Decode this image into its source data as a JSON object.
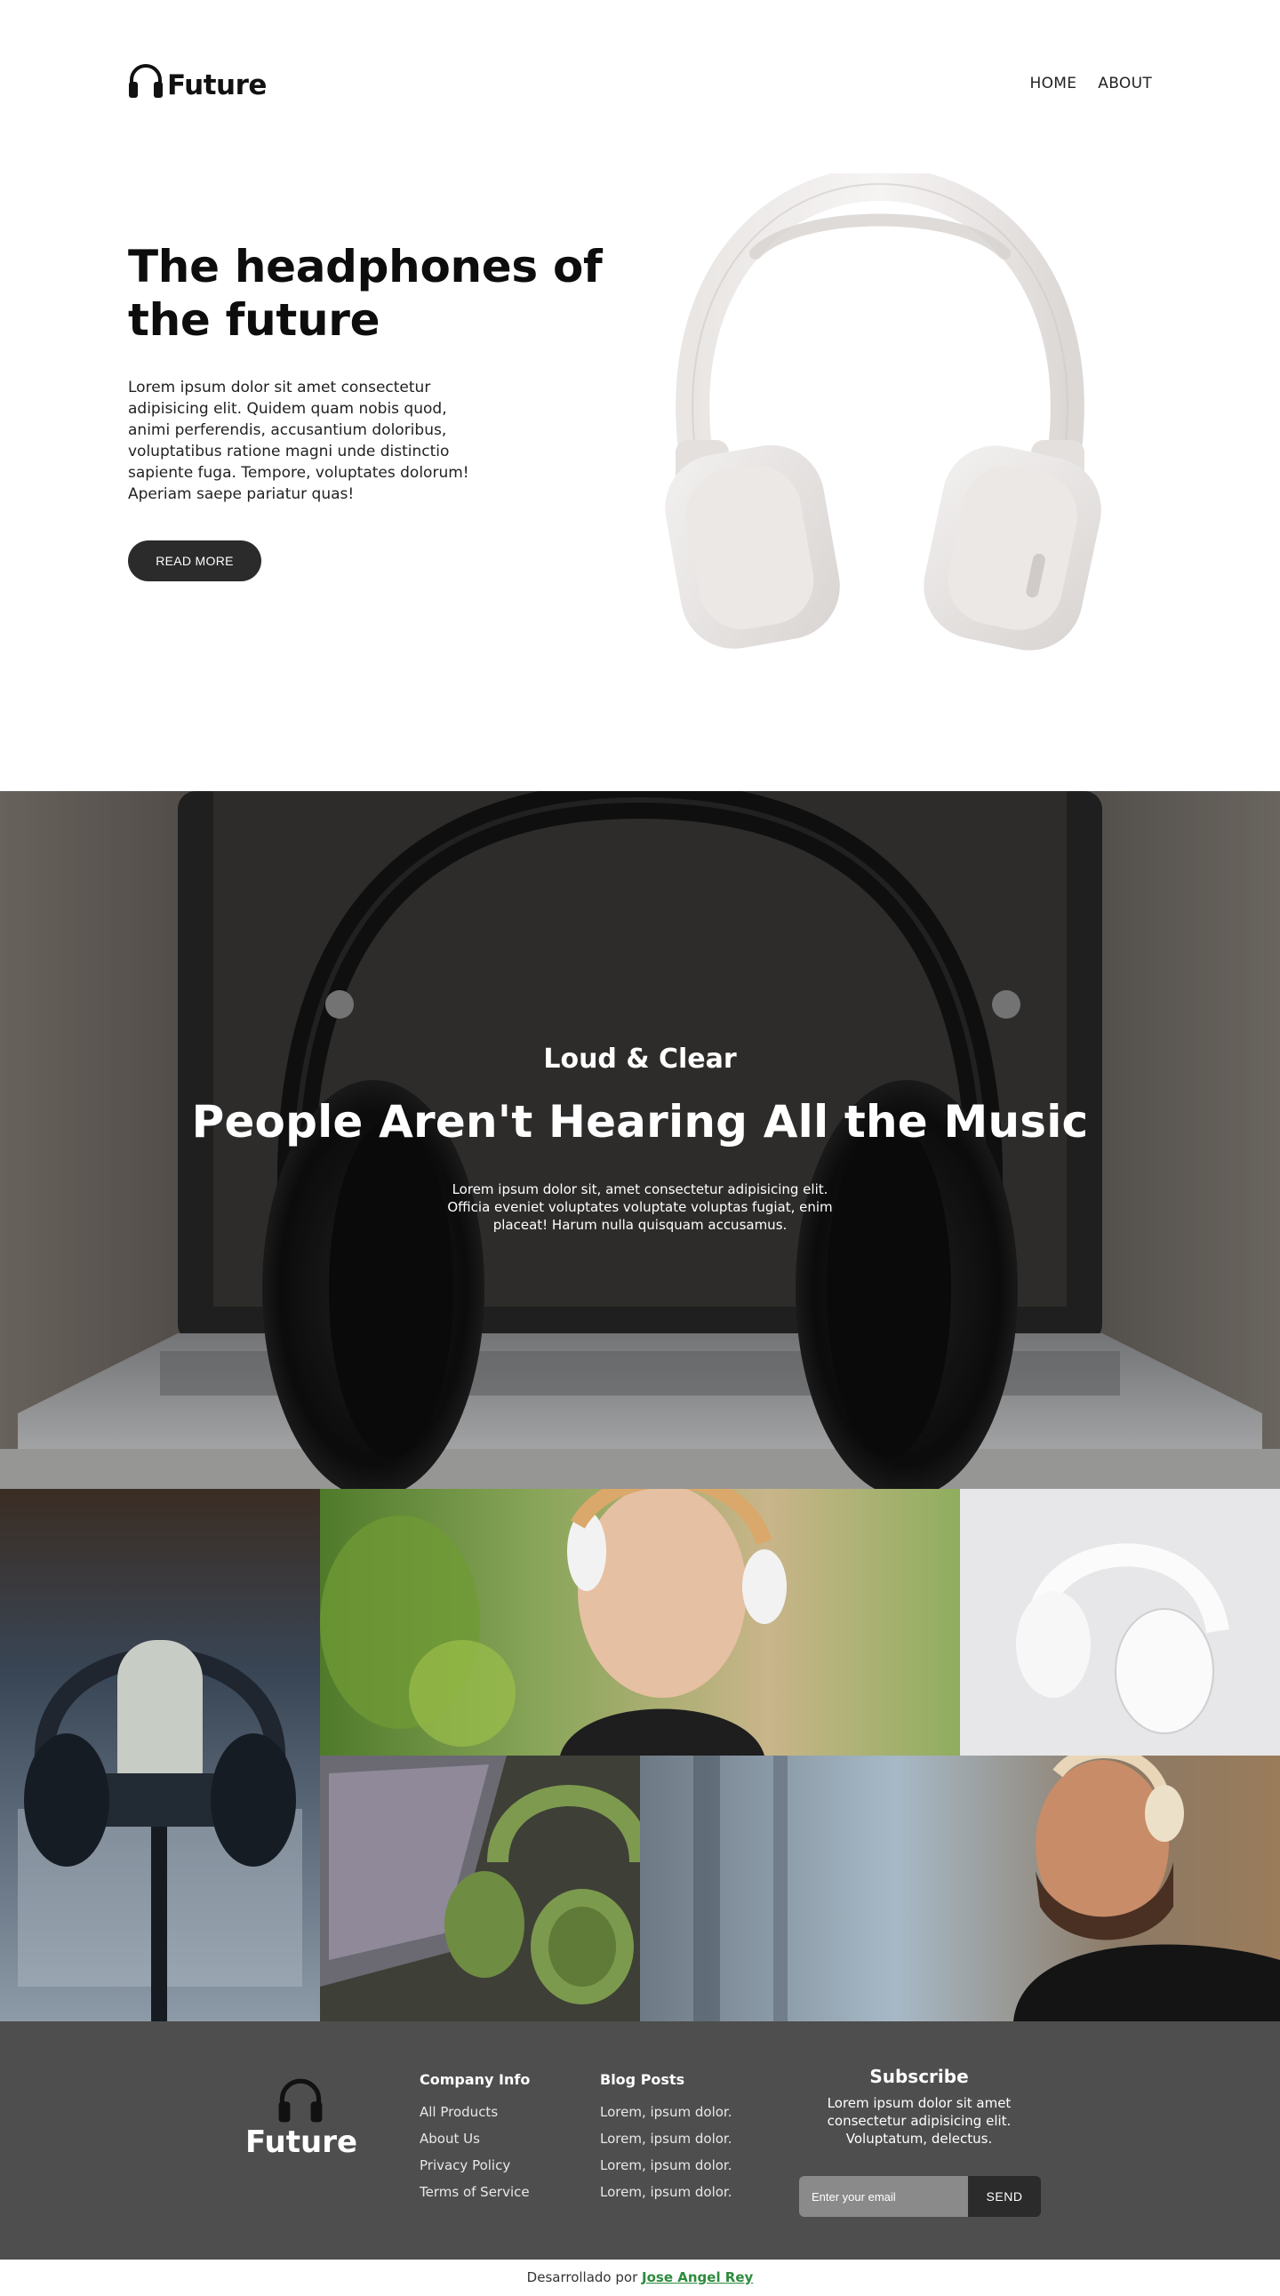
{
  "header": {
    "brand": "Future",
    "nav": [
      {
        "label": "HOME"
      },
      {
        "label": "ABOUT"
      }
    ]
  },
  "hero": {
    "title": "The headphones of the future",
    "text": "Lorem ipsum dolor sit amet consectetur adipisicing elit. Quidem quam nobis quod, animi perferendis, accusantium doloribus, voluptatibus ratione magni unde distinctio sapiente fuga. Tempore, voluptates dolorum! Aperiam saepe pariatur quas!",
    "button_label": "READ MORE"
  },
  "banner": {
    "subtitle": "Loud & Clear",
    "title": "People Aren't Hearing All the Music",
    "text": "Lorem ipsum dolor sit, amet consectetur adipisicing elit. Officia eveniet voluptates voluptate voluptas fugiat, enim placeat! Harum nulla quisquam accusamus."
  },
  "gallery": {
    "images": [
      {
        "name": "microphone-with-headphones-photo"
      },
      {
        "name": "woman-listening-photo"
      },
      {
        "name": "white-headphones-photo"
      },
      {
        "name": "green-headphones-photo"
      },
      {
        "name": "smiling-man-photo"
      }
    ]
  },
  "footer": {
    "brand": "Future",
    "company": {
      "heading": "Company Info",
      "links": [
        "All Products",
        "About Us",
        "Privacy Policy",
        "Terms of Service"
      ]
    },
    "blog": {
      "heading": "Blog Posts",
      "links": [
        "Lorem, ipsum dolor.",
        "Lorem, ipsum dolor.",
        "Lorem, ipsum dolor.",
        "Lorem, ipsum dolor."
      ]
    },
    "subscribe": {
      "heading": "Subscribe",
      "text": "Lorem ipsum dolor sit amet consectetur adipisicing elit. Voluptatum, delectus.",
      "placeholder": "Enter your email",
      "button_label": "SEND"
    }
  },
  "credits": {
    "prefix": "Desarrollado por",
    "author": "Jose Angel Rey"
  },
  "colors": {
    "dark_button": "#2b2b2b",
    "footer_bg": "#4e4e4e",
    "credit_link": "#2e8b3d"
  }
}
